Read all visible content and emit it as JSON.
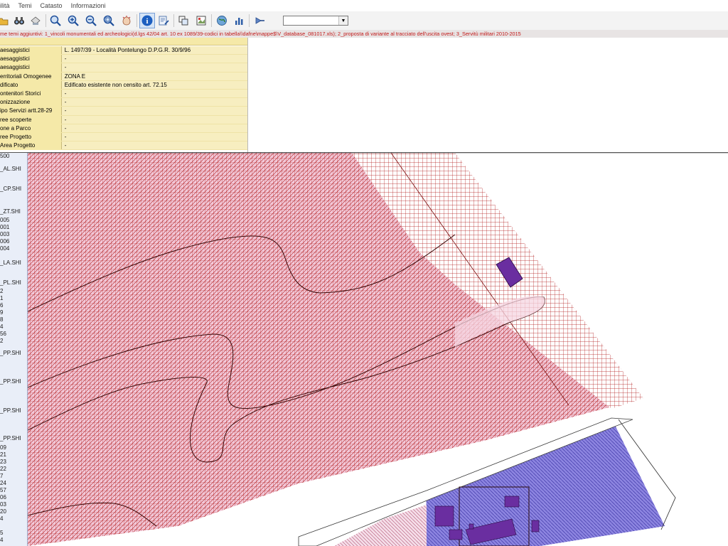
{
  "menu": [
    "ilità",
    "Temi",
    "Catasto",
    "Informazioni"
  ],
  "toolbar": {
    "icons": [
      "folder-icon",
      "binoculars-icon",
      "print-icon",
      "zoom-icon",
      "zoom-in-icon",
      "zoom-out-icon",
      "zoom-window-icon",
      "pan-hand-icon",
      "info-icon",
      "edit-doc-icon",
      "layers-icon",
      "image-icon",
      "globe-icon",
      "chart-icon",
      "arrow-tool-icon"
    ],
    "layer_select_value": ""
  },
  "themes_bar": "me temi aggiuntivi: 1_vincoli monumentali ed archeologici(d.lgs 42/04 art. 10 ex 1089/39-codici in tabella\\\\dafne\\mappe$\\V_database_081017.xls); 2_proposta di variante al tracciato dell'uscita ovest; 3_Servitù militari 2010-2015",
  "attributes": [
    {
      "key": "aesaggistici",
      "value": "L. 1497/39 - Località Pontelungo  D.P.G.R. 30/9/96"
    },
    {
      "key": "aesaggistici",
      "value": "-"
    },
    {
      "key": "aesaggistici",
      "value": "-"
    },
    {
      "key": "erritoriali Omogenee",
      "value": "ZONA E"
    },
    {
      "key": "dificato",
      "value": "Edificato esistente non censito art. 72.15"
    },
    {
      "key": "ontenitori Storici",
      "value": "-"
    },
    {
      "key": "onizzazione",
      "value": "-"
    },
    {
      "key": "ipo Servizi artt.28-29",
      "value": "-"
    },
    {
      "key": "ree scoperte",
      "value": "-"
    },
    {
      "key": "one a Parco",
      "value": "-"
    },
    {
      "key": "ree Progetto",
      "value": "-"
    },
    {
      "key": "Area Progetto",
      "value": "-"
    }
  ],
  "legend": [
    "500",
    "_AL.SHI",
    "_CP.SHI",
    "_ZT.SHI",
    "005",
    "001",
    "003",
    "006",
    "004",
    "_LA.SHI",
    "_PL.SHI",
    "2",
    "1",
    "6",
    "9",
    "8",
    "4",
    "56",
    "2",
    "_PP.SHI",
    "_PP.SHI",
    "_PP.SHI",
    "_PP.SHI",
    "09",
    "21",
    "23",
    "22",
    "7",
    "24",
    "57",
    "06",
    "03",
    "20",
    "4",
    "5",
    "4"
  ],
  "map_colors": {
    "pink_fill": "#f2c8d8",
    "grid_red": "#b01818",
    "purple_fill": "#8c84e0",
    "building": "#6a2ea0",
    "outline": "#2a0a0a"
  }
}
